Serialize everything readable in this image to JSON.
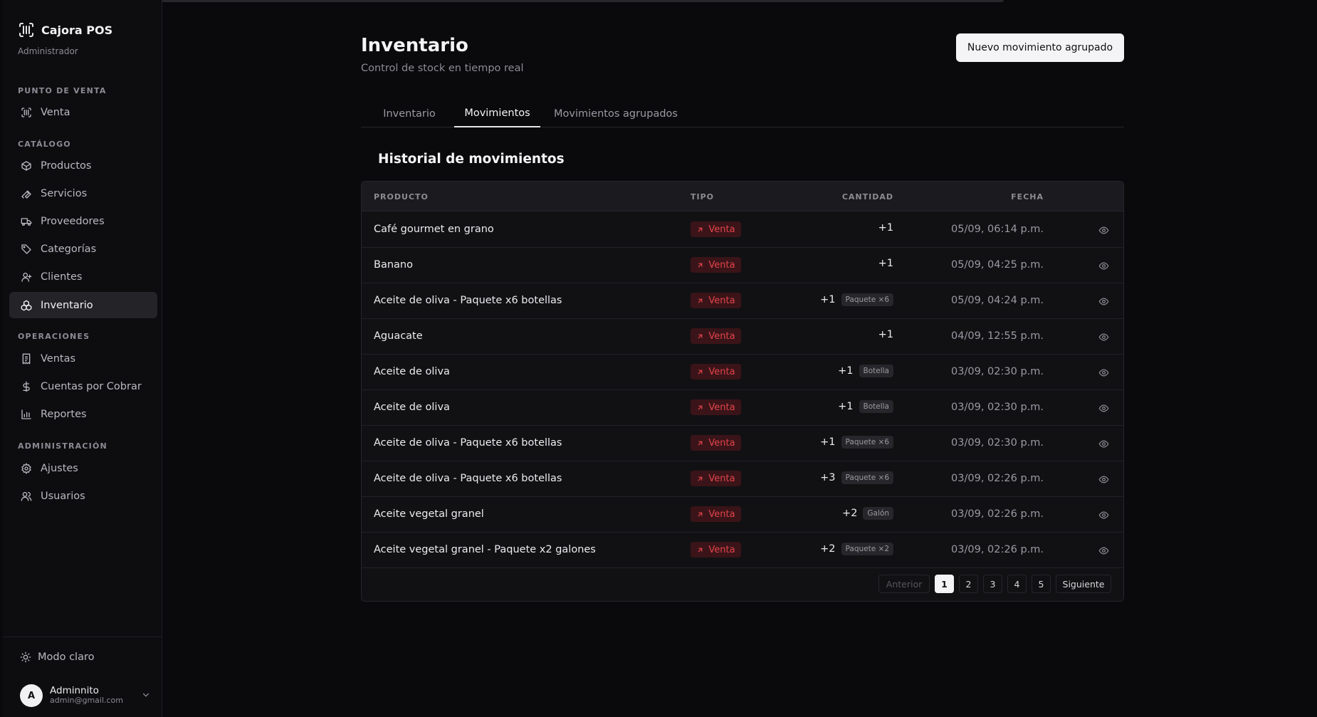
{
  "app": {
    "name": "Cajora POS",
    "role": "Administrador"
  },
  "sidebar": {
    "sections": [
      {
        "title": "PUNTO DE VENTA",
        "items": [
          {
            "label": "Venta",
            "icon": "scan-icon"
          }
        ]
      },
      {
        "title": "CATÁLOGO",
        "items": [
          {
            "label": "Productos",
            "icon": "box-icon"
          },
          {
            "label": "Servicios",
            "icon": "wrench-icon"
          },
          {
            "label": "Proveedores",
            "icon": "truck-icon"
          },
          {
            "label": "Categorías",
            "icon": "tag-icon"
          },
          {
            "label": "Clientes",
            "icon": "user-icon"
          },
          {
            "label": "Inventario",
            "icon": "boxes-icon",
            "active": true
          }
        ]
      },
      {
        "title": "OPERACIONES",
        "items": [
          {
            "label": "Ventas",
            "icon": "receipt-icon"
          },
          {
            "label": "Cuentas por Cobrar",
            "icon": "dollar-icon"
          },
          {
            "label": "Reportes",
            "icon": "bar-chart-icon"
          }
        ]
      },
      {
        "title": "ADMINISTRACIÓN",
        "items": [
          {
            "label": "Ajustes",
            "icon": "gear-icon"
          },
          {
            "label": "Usuarios",
            "icon": "users-icon"
          }
        ]
      }
    ],
    "mode_toggle": "Modo claro",
    "user": {
      "initial": "A",
      "name": "Adminnito",
      "email": "admin@gmail.com"
    }
  },
  "header": {
    "title": "Inventario",
    "subtitle": "Control de stock en tiempo real",
    "primary_action": "Nuevo movimiento agrupado"
  },
  "tabs": [
    {
      "label": "Inventario",
      "active": false
    },
    {
      "label": "Movimientos",
      "active": true
    },
    {
      "label": "Movimientos agrupados",
      "active": false
    }
  ],
  "movements": {
    "title": "Historial de movimientos",
    "columns": {
      "product": "PRODUCTO",
      "type": "TIPO",
      "quantity": "CANTIDAD",
      "date": "FECHA"
    },
    "rows": [
      {
        "product": "Café gourmet en grano",
        "type": "Venta",
        "qty": "+1",
        "unit": "",
        "date": "05/09, 06:14 p.m."
      },
      {
        "product": "Banano",
        "type": "Venta",
        "qty": "+1",
        "unit": "",
        "date": "05/09, 04:25 p.m."
      },
      {
        "product": "Aceite de oliva - Paquete x6 botellas",
        "type": "Venta",
        "qty": "+1",
        "unit": "Paquete ×6",
        "date": "05/09, 04:24 p.m."
      },
      {
        "product": "Aguacate",
        "type": "Venta",
        "qty": "+1",
        "unit": "",
        "date": "04/09, 12:55 p.m."
      },
      {
        "product": "Aceite de oliva",
        "type": "Venta",
        "qty": "+1",
        "unit": "Botella",
        "date": "03/09, 02:30 p.m."
      },
      {
        "product": "Aceite de oliva",
        "type": "Venta",
        "qty": "+1",
        "unit": "Botella",
        "date": "03/09, 02:30 p.m."
      },
      {
        "product": "Aceite de oliva - Paquete x6 botellas",
        "type": "Venta",
        "qty": "+1",
        "unit": "Paquete ×6",
        "date": "03/09, 02:30 p.m."
      },
      {
        "product": "Aceite de oliva - Paquete x6 botellas",
        "type": "Venta",
        "qty": "+3",
        "unit": "Paquete ×6",
        "date": "03/09, 02:26 p.m."
      },
      {
        "product": "Aceite vegetal granel",
        "type": "Venta",
        "qty": "+2",
        "unit": "Galón",
        "date": "03/09, 02:26 p.m."
      },
      {
        "product": "Aceite vegetal granel - Paquete x2 galones",
        "type": "Venta",
        "qty": "+2",
        "unit": "Paquete ×2",
        "date": "03/09, 02:26 p.m."
      }
    ]
  },
  "pagination": {
    "prev": "Anterior",
    "pages": [
      "1",
      "2",
      "3",
      "4",
      "5"
    ],
    "current": "1",
    "next": "Siguiente"
  },
  "colors": {
    "accent_red": "#e2444b",
    "badge_red_bg": "#3a1418",
    "active_bg": "#232328"
  }
}
